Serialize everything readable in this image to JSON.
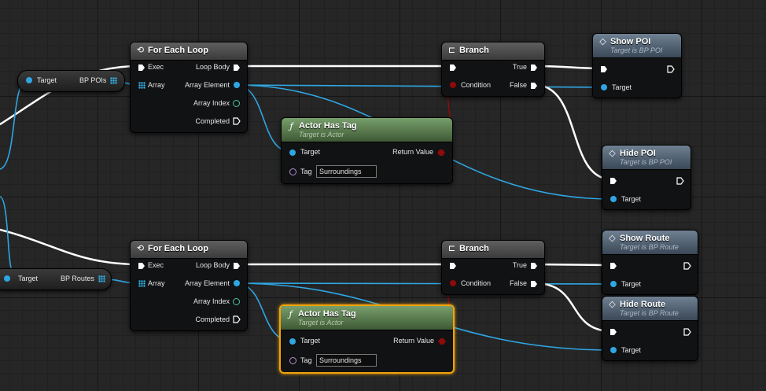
{
  "colors": {
    "exec": "#ffffff",
    "object": "#2fa6e3",
    "boolean": "#8c0b0b",
    "integer": "#4cc7a4",
    "tag": "#b28fd6",
    "selected": "#f0a30a"
  },
  "vars": {
    "pois": {
      "target_label": "Target",
      "name": "BP POIs",
      "icon": "array-icon"
    },
    "routes": {
      "target_label": "Target",
      "name": "BP Routes",
      "icon": "array-icon"
    }
  },
  "loops": [
    {
      "title": "For Each Loop",
      "icon": "loop-icon",
      "exec": "Exec",
      "array": "Array",
      "loop_body": "Loop Body",
      "element": "Array Element",
      "index": "Array Index",
      "completed": "Completed"
    },
    {
      "title": "For Each Loop",
      "icon": "loop-icon",
      "exec": "Exec",
      "array": "Array",
      "loop_body": "Loop Body",
      "element": "Array Element",
      "index": "Array Index",
      "completed": "Completed"
    }
  ],
  "tagnodes": [
    {
      "title": "Actor Has Tag",
      "subtitle": "Target is Actor",
      "target": "Target",
      "return": "Return Value",
      "tag_label": "Tag",
      "tag_value": "Surroundings",
      "icon": "function-icon"
    },
    {
      "title": "Actor Has Tag",
      "subtitle": "Target is Actor",
      "target": "Target",
      "return": "Return Value",
      "tag_label": "Tag",
      "tag_value": "Surroundings",
      "icon": "function-icon"
    }
  ],
  "branches": [
    {
      "title": "Branch",
      "condition": "Condition",
      "true": "True",
      "false": "False",
      "icon": "branch-icon"
    },
    {
      "title": "Branch",
      "condition": "Condition",
      "true": "True",
      "false": "False",
      "icon": "branch-icon"
    }
  ],
  "events": {
    "show_poi": {
      "title": "Show POI",
      "subtitle": "Target is BP POI",
      "target": "Target",
      "icon": "event-icon"
    },
    "hide_poi": {
      "title": "Hide POI",
      "subtitle": "Target is BP POI",
      "target": "Target",
      "icon": "event-icon"
    },
    "show_route": {
      "title": "Show Route",
      "subtitle": "Target is BP Route",
      "target": "Target",
      "icon": "event-icon"
    },
    "hide_route": {
      "title": "Hide Route",
      "subtitle": "Target is BP Route",
      "target": "Target",
      "icon": "event-icon"
    }
  }
}
